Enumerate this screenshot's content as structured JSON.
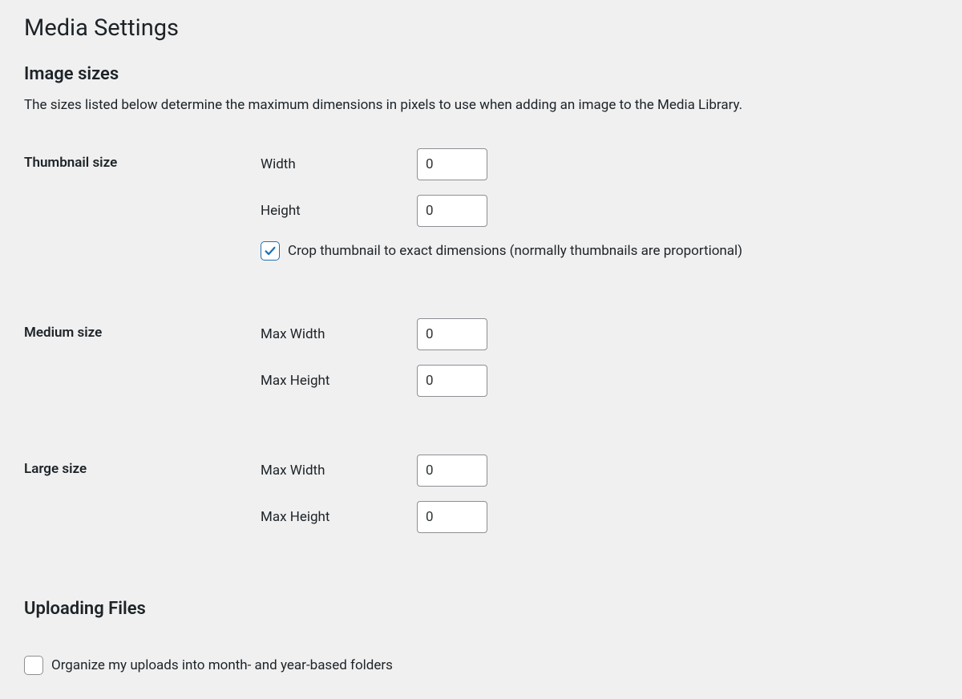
{
  "page": {
    "title": "Media Settings"
  },
  "sections": {
    "imageSizes": {
      "heading": "Image sizes",
      "description": "The sizes listed below determine the maximum dimensions in pixels to use when adding an image to the Media Library.",
      "thumbnail": {
        "label": "Thumbnail size",
        "widthLabel": "Width",
        "widthValue": "0",
        "heightLabel": "Height",
        "heightValue": "0",
        "cropChecked": true,
        "cropLabel": "Crop thumbnail to exact dimensions (normally thumbnails are proportional)"
      },
      "medium": {
        "label": "Medium size",
        "maxWidthLabel": "Max Width",
        "maxWidthValue": "0",
        "maxHeightLabel": "Max Height",
        "maxHeightValue": "0"
      },
      "large": {
        "label": "Large size",
        "maxWidthLabel": "Max Width",
        "maxWidthValue": "0",
        "maxHeightLabel": "Max Height",
        "maxHeightValue": "0"
      }
    },
    "uploadingFiles": {
      "heading": "Uploading Files",
      "organizeChecked": false,
      "organizeLabel": "Organize my uploads into month- and year-based folders"
    }
  }
}
